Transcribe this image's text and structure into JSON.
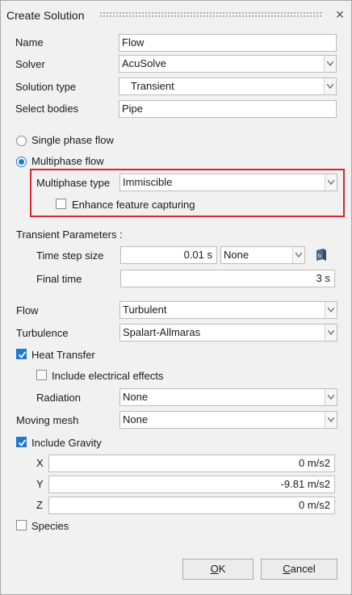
{
  "window": {
    "title": "Create Solution",
    "close_glyph": "✕"
  },
  "form": {
    "name": {
      "label": "Name",
      "value": "Flow"
    },
    "solver": {
      "label": "Solver",
      "value": "AcuSolve"
    },
    "solution_type": {
      "label": "Solution type",
      "value": "Transient"
    },
    "select_bodies": {
      "label": "Select bodies",
      "value": "Pipe"
    },
    "phase": {
      "single_label": "Single phase flow",
      "multi_label": "Multiphase flow",
      "selected": "multi"
    },
    "multiphase_type": {
      "label": "Multiphase type",
      "value": "Immiscible"
    },
    "enhance_feature": {
      "label": "Enhance feature capturing",
      "checked": false
    },
    "transient": {
      "heading": "Transient Parameters :",
      "time_step": {
        "label": "Time step size",
        "value": "0.01 s",
        "option": "None"
      },
      "final_time": {
        "label": "Final time",
        "value": "3 s"
      }
    },
    "flow": {
      "label": "Flow",
      "value": "Turbulent"
    },
    "turbulence": {
      "label": "Turbulence",
      "value": "Spalart-Allmaras"
    },
    "heat_transfer": {
      "label": "Heat Transfer",
      "checked": true
    },
    "electrical": {
      "label": "Include electrical effects",
      "checked": false
    },
    "radiation": {
      "label": "Radiation",
      "value": "None"
    },
    "moving_mesh": {
      "label": "Moving mesh",
      "value": "None"
    },
    "gravity": {
      "label": "Include Gravity",
      "checked": true,
      "x": {
        "label": "X",
        "value": "0 m/s2"
      },
      "y": {
        "label": "Y",
        "value": "-9.81 m/s2"
      },
      "z": {
        "label": "Z",
        "value": "0 m/s2"
      }
    },
    "species": {
      "label": "Species",
      "checked": false
    }
  },
  "buttons": {
    "ok": {
      "label": "OK",
      "mnemonic": "O",
      "rest": "K"
    },
    "cancel": {
      "label": "Cancel",
      "mnemonic": "C",
      "rest": "ancel"
    }
  },
  "colors": {
    "accent": "#1f7ad0",
    "highlight_border": "#d9262c",
    "background": "#f1f1f1"
  },
  "icons": {
    "combo_arrow": "chevron-down-icon",
    "expression": "expression-editor-icon",
    "check": "checkmark-icon"
  }
}
